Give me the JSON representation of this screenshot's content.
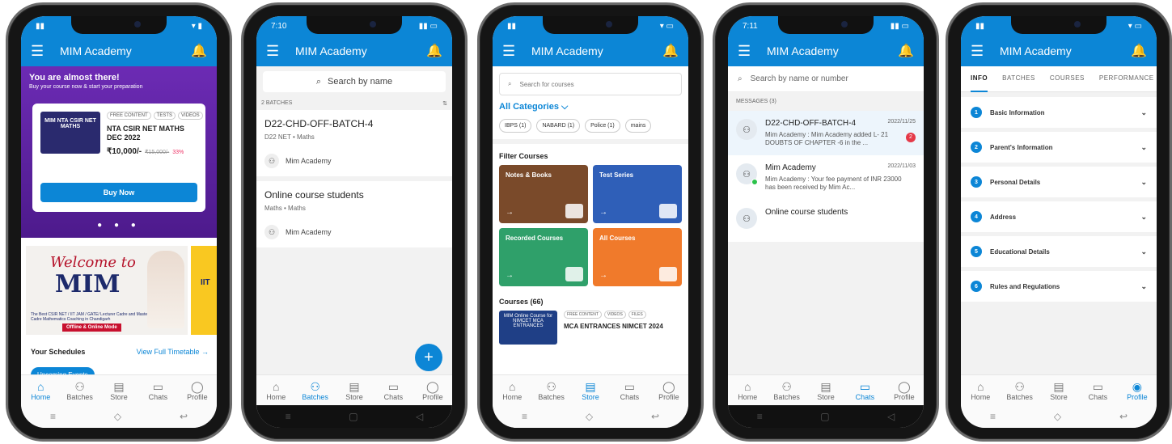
{
  "app_title": "MIM Academy",
  "tabs": {
    "home": "Home",
    "batches": "Batches",
    "store": "Store",
    "chats": "Chats",
    "profile": "Profile"
  },
  "status": {
    "p2_time": "7:10",
    "p4_time": "7:11"
  },
  "home": {
    "hero_title": "You are almost there!",
    "hero_subtitle": "Buy your course now & start your preparation",
    "card_chips": [
      "FREE CONTENT",
      "TESTS",
      "VIDEOS"
    ],
    "card_title": "NTA CSIR NET MATHS DEC 2022",
    "thumb_text": "MIM NTA CSIR NET MATHS",
    "price": "₹10,000/-",
    "old_price": "₹15,000/-",
    "discount": "33%",
    "buy_label": "Buy Now",
    "banner_welcome": "Welcome to",
    "banner_mim": "MIM",
    "banner_tagline": "The Best CSIR NET / IIT JAM / GATE/ Lecturer Cadre and Master Cadre Mathematics Coaching in Chandigarh",
    "banner_mode": "Offline & Online Mode",
    "banner2_text": "IIT",
    "schedules_title": "Your Schedules",
    "schedules_link": "View Full Timetable →",
    "upcoming_label": "Upcoming Events"
  },
  "batches": {
    "search_placeholder": "Search by name",
    "count_label": "2 BATCHES",
    "items": [
      {
        "name": "D22-CHD-OFF-BATCH-4",
        "sub": "D22 NET • Maths",
        "owner": "Mim Academy"
      },
      {
        "name": "Online course students",
        "sub": "Maths • Maths",
        "owner": "Mim Academy"
      }
    ]
  },
  "store": {
    "search_placeholder": "Search for courses",
    "categories_label": "All Categories ⌵",
    "chips": [
      "IBPS (1)",
      "NABARD (1)",
      "Police (1)",
      "mains"
    ],
    "filter_title": "Filter Courses",
    "tiles": [
      {
        "label": "Notes & Books",
        "color": "#7a4a2a"
      },
      {
        "label": "Test Series",
        "color": "#2f5fb8"
      },
      {
        "label": "Recorded Courses",
        "color": "#2fa06a"
      },
      {
        "label": "All Courses",
        "color": "#f07a2b"
      }
    ],
    "courses_title": "Courses (66)",
    "course": {
      "chips": [
        "FREE CONTENT",
        "VIDEOS",
        "FILES"
      ],
      "title": "MCA ENTRANCES NIMCET 2024",
      "thumb": "MIM Online Course for NIMCET MCA ENTRANCES"
    }
  },
  "chats": {
    "search_placeholder": "Search by name or number",
    "messages_label": "MESSAGES (3)",
    "items": [
      {
        "name": "D22-CHD-OFF-BATCH-4",
        "date": "2022/11/25",
        "preview": "Mim Academy : Mim Academy added L- 21 DOUBTS OF CHAPTER -6 in the ...",
        "badge": "2"
      },
      {
        "name": "Mim Academy",
        "date": "2022/11/03",
        "preview": "Mim Academy : Your fee payment of INR 23000 has been received by Mim Ac..."
      },
      {
        "name": "Online course students"
      }
    ]
  },
  "profile": {
    "tabs": [
      "INFO",
      "BATCHES",
      "COURSES",
      "PERFORMANCE"
    ],
    "sections": [
      "Basic Information",
      "Parent's Information",
      "Personal Details",
      "Address",
      "Educational Details",
      "Rules and Regulations"
    ]
  }
}
